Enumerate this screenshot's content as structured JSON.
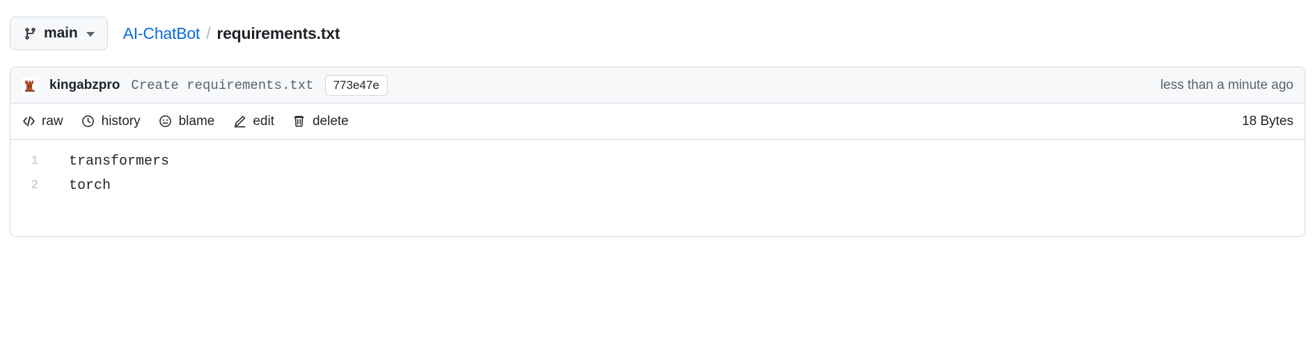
{
  "topbar": {
    "branch": {
      "icon": "git-branch-icon",
      "label": "main",
      "caret": "chevron-down-icon"
    },
    "breadcrumb": {
      "repo": "AI-ChatBot",
      "separator": "/",
      "file": "requirements.txt"
    }
  },
  "commit": {
    "avatar_alt": "kingabzpro-avatar",
    "author": "kingabzpro",
    "message": "Create requirements.txt",
    "sha": "773e47e",
    "time": "less than a minute ago"
  },
  "toolbar": {
    "actions": [
      {
        "icon": "code-icon",
        "label": "raw"
      },
      {
        "icon": "clock-icon",
        "label": "history"
      },
      {
        "icon": "blame-circle-icon",
        "label": "blame"
      },
      {
        "icon": "pencil-icon",
        "label": "edit"
      },
      {
        "icon": "trash-icon",
        "label": "delete"
      }
    ],
    "filesize": "18 Bytes"
  },
  "file_content": {
    "lines": [
      {
        "number": "1",
        "text": "transformers"
      },
      {
        "number": "2",
        "text": "torch"
      }
    ]
  },
  "colors": {
    "link": "#0969da",
    "muted": "#59636e",
    "border": "#d1d9e0",
    "header_bg": "#f6f8fa",
    "text": "#1f2328",
    "line_number": "#bcc4cc",
    "avatar_accent": "#b5562b"
  }
}
